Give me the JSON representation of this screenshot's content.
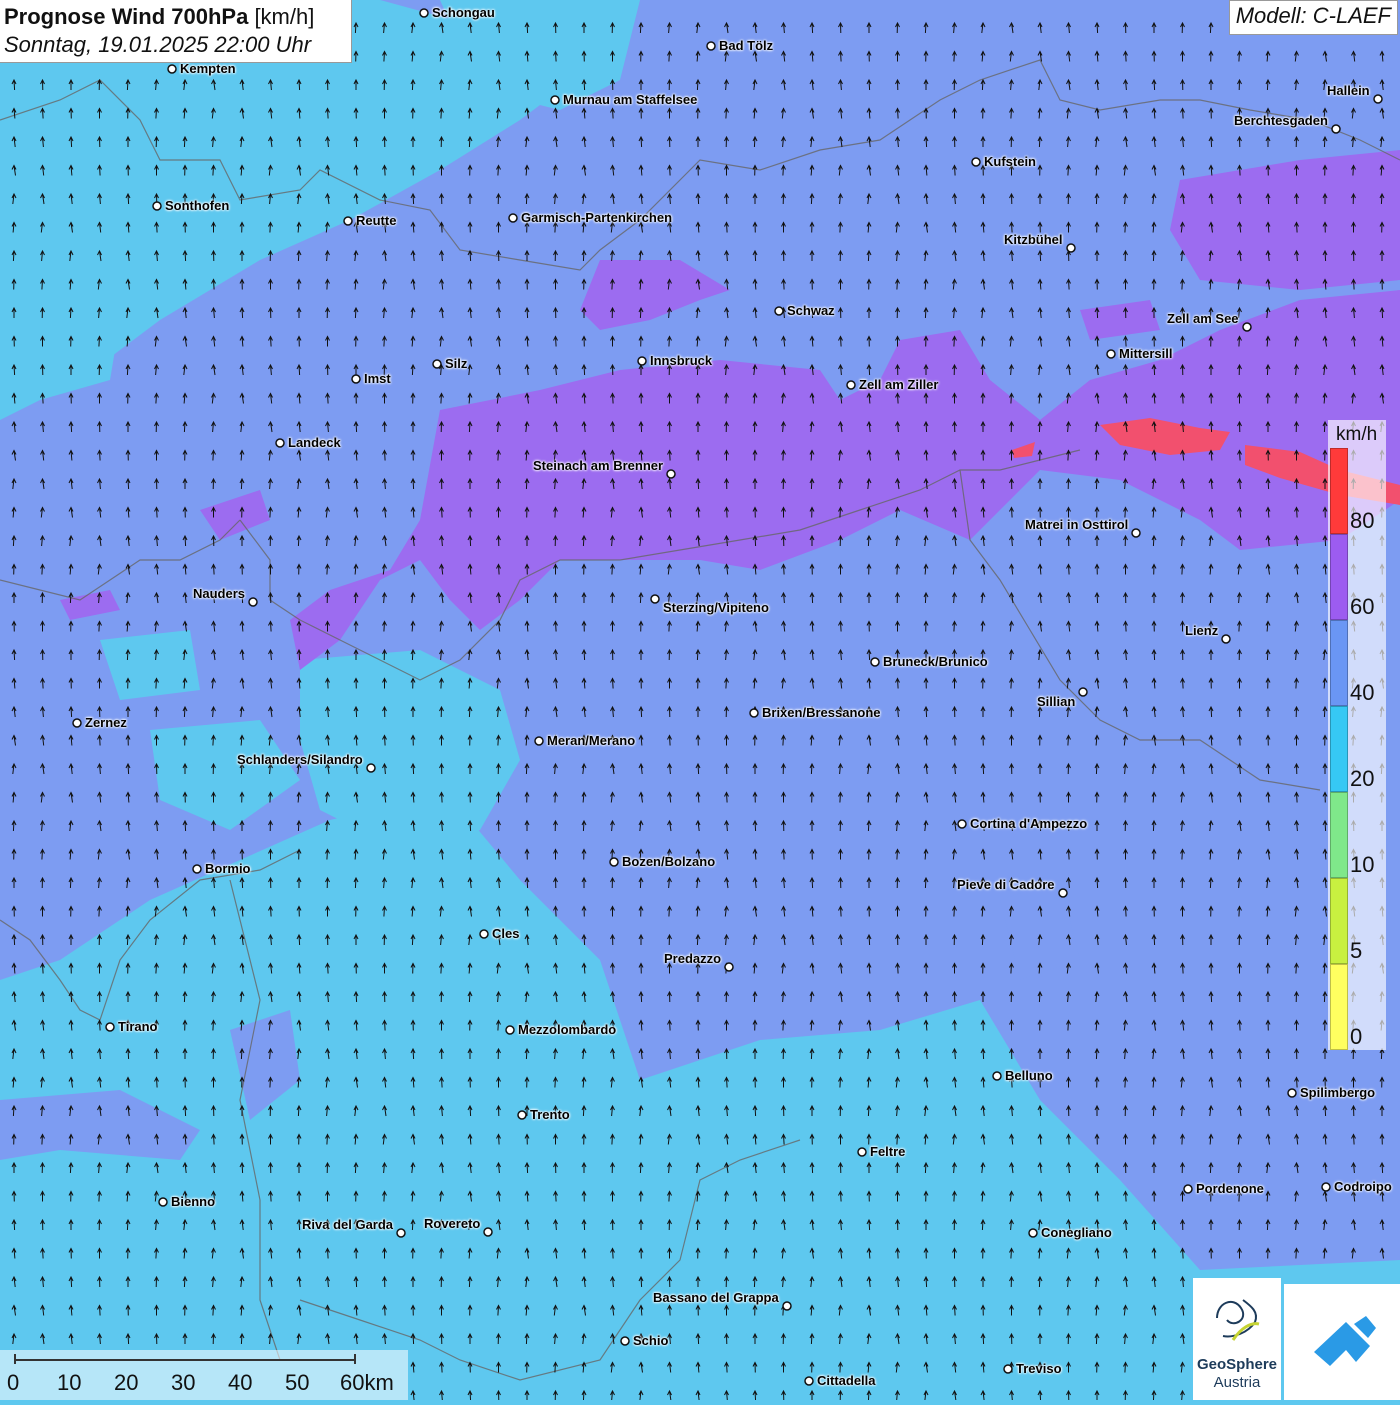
{
  "header": {
    "title_bold": "Prognose Wind 700hPa",
    "title_unit": "[km/h]",
    "subtitle": "Sonntag, 19.01.2025 22:00 Uhr"
  },
  "model": {
    "label": "Modell: C-LAEF"
  },
  "legend": {
    "unit": "km/h",
    "ticks": [
      "80",
      "60",
      "40",
      "20",
      "10",
      "5",
      "0"
    ],
    "colors": [
      "#ff3a3a",
      "#9c5cf0",
      "#6a96f4",
      "#36c8f4",
      "#7fe88a",
      "#c8f040",
      "#ffff60"
    ]
  },
  "scale": {
    "labels": [
      "0",
      "10",
      "20",
      "30",
      "40",
      "50",
      "60km"
    ]
  },
  "branding": {
    "line1": "GeoSphere",
    "line2": "Austria"
  },
  "cities": [
    {
      "name": "Schongau"
    },
    {
      "name": "Bad Tölz"
    },
    {
      "name": "Kempten"
    },
    {
      "name": "Murnau am Staffelsee"
    },
    {
      "name": "Hallein"
    },
    {
      "name": "Berchtesgaden"
    },
    {
      "name": "Kufstein"
    },
    {
      "name": "Sonthofen"
    },
    {
      "name": "Reutte"
    },
    {
      "name": "Garmisch-Partenkirchen"
    },
    {
      "name": "Kitzbühel"
    },
    {
      "name": "Schwaz"
    },
    {
      "name": "Zell am See"
    },
    {
      "name": "Mittersill"
    },
    {
      "name": "Imst"
    },
    {
      "name": "Silz"
    },
    {
      "name": "Innsbruck"
    },
    {
      "name": "Zell am Ziller"
    },
    {
      "name": "Landeck"
    },
    {
      "name": "Steinach am Brenner"
    },
    {
      "name": "Matrei in Osttirol"
    },
    {
      "name": "Nauders"
    },
    {
      "name": "Sterzing/Vipiteno"
    },
    {
      "name": "Lienz"
    },
    {
      "name": "Bruneck/Brunico"
    },
    {
      "name": "Sillian"
    },
    {
      "name": "Zernez"
    },
    {
      "name": "Brixen/Bressanone"
    },
    {
      "name": "Meran/Merano"
    },
    {
      "name": "Schlanders/Silandro"
    },
    {
      "name": "Cortina d'Ampezzo"
    },
    {
      "name": "Bozen/Bolzano"
    },
    {
      "name": "Bormio"
    },
    {
      "name": "Pieve di Cadore"
    },
    {
      "name": "Cles"
    },
    {
      "name": "Predazzo"
    },
    {
      "name": "Tirano"
    },
    {
      "name": "Mezzolombardo"
    },
    {
      "name": "Belluno"
    },
    {
      "name": "Spilimbergo"
    },
    {
      "name": "Trento"
    },
    {
      "name": "Feltre"
    },
    {
      "name": "Bienno"
    },
    {
      "name": "Pordenone"
    },
    {
      "name": "Codroipo"
    },
    {
      "name": "Riva del Garda"
    },
    {
      "name": "Rovereto"
    },
    {
      "name": "Conegliano"
    },
    {
      "name": "Bassano del Grappa"
    },
    {
      "name": "Schio"
    },
    {
      "name": "Treviso"
    },
    {
      "name": "Cittadella"
    }
  ]
}
